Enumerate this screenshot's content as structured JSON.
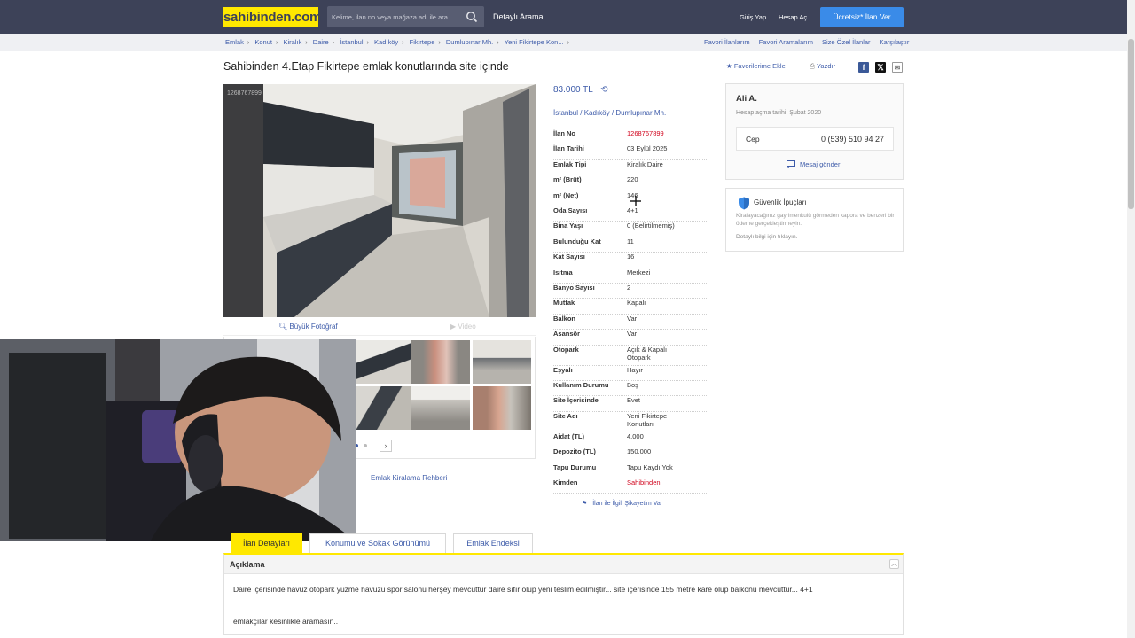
{
  "header": {
    "logo": "sahibinden.com",
    "search_placeholder": "Kelime, ilan no veya mağaza adı ile ara",
    "advanced_search": "Detaylı Arama",
    "login": "Giriş Yap",
    "register": "Hesap Aç",
    "post_ad": "Ücretsiz* İlan Ver"
  },
  "breadcrumb": {
    "items": [
      "Emlak",
      "Konut",
      "Kiralık",
      "Daire",
      "İstanbul",
      "Kadıköy",
      "Fikirtepe",
      "Dumlupınar Mh.",
      "Yeni Fikirtepe Kon..."
    ],
    "right_links": [
      "Favori İlanlarım",
      "Favori Aramalarım",
      "Size Özel İlanlar",
      "Karşılaştır"
    ]
  },
  "listing": {
    "title": "Sahibinden 4.Etap Fikirtepe emlak konutlarında site içinde",
    "add_favorites": "Favorilerime Ekle",
    "print": "Yazdır",
    "photo_id": "1268767899",
    "big_photo": "Büyük Fotoğraf",
    "video": "Video",
    "rental_guide": "Emlak Kiralama Rehberi",
    "price": "83.000 TL",
    "location": [
      "İstanbul",
      "Kadıköy",
      "Dumlupınar Mh."
    ],
    "specs": [
      {
        "label": "İlan No",
        "value": "1268767899"
      },
      {
        "label": "İlan Tarihi",
        "value": "03 Eylül 2025"
      },
      {
        "label": "Emlak Tipi",
        "value": "Kiralık Daire"
      },
      {
        "label": "m² (Brüt)",
        "value": "220"
      },
      {
        "label": "m² (Net)",
        "value": "146"
      },
      {
        "label": "Oda Sayısı",
        "value": "4+1"
      },
      {
        "label": "Bina Yaşı",
        "value": "0 (Belirtilmemiş)"
      },
      {
        "label": "Bulunduğu Kat",
        "value": "11"
      },
      {
        "label": "Kat Sayısı",
        "value": "16"
      },
      {
        "label": "Isıtma",
        "value": "Merkezi"
      },
      {
        "label": "Banyo Sayısı",
        "value": "2"
      },
      {
        "label": "Mutfak",
        "value": "Kapalı"
      },
      {
        "label": "Balkon",
        "value": "Var"
      },
      {
        "label": "Asansör",
        "value": "Var"
      },
      {
        "label": "Otopark",
        "value": "Açık & Kapalı Otopark"
      },
      {
        "label": "Eşyalı",
        "value": "Hayır"
      },
      {
        "label": "Kullanım Durumu",
        "value": "Boş"
      },
      {
        "label": "Site İçerisinde",
        "value": "Evet"
      },
      {
        "label": "Site Adı",
        "value": "Yeni Fikirtepe Konutları"
      },
      {
        "label": "Aidat (TL)",
        "value": "4.000"
      },
      {
        "label": "Depozito (TL)",
        "value": "150.000"
      },
      {
        "label": "Tapu Durumu",
        "value": "Tapu Kaydı Yok"
      },
      {
        "label": "Kimden",
        "value": "Sahibinden"
      }
    ],
    "complaint": "İlan ile İlgili Şikayetim Var"
  },
  "seller": {
    "name": "Ali A.",
    "member_since": "Hesap açma tarihi: Şubat 2020",
    "phone_label": "Cep",
    "phone": "0 (539) 510 94 27",
    "send_message": "Mesaj gönder"
  },
  "safety": {
    "title": "Güvenlik İpuçları",
    "text": "Kiralayacağınız gayrimenkulü görmeden kapora ve benzeri bir ödeme gerçekleştirmeyin.",
    "link": "Detaylı bilgi için tıklayın."
  },
  "tabs": [
    "İlan Detayları",
    "Konumu ve Sokak Görünümü",
    "Emlak Endeksi"
  ],
  "description": {
    "heading": "Açıklama",
    "text1": "Daire içerisinde havuz otopark yüzme havuzu spor salonu herşey mevcuttur daire sıfır olup yeni teslim edilmiştir... site içerisinde 155 metre kare olup balkonu mevcuttur... 4+1",
    "text2": "emlakçılar kesinlikle aramasın.."
  },
  "colors": {
    "header_bg": "#3d4258",
    "logo_yellow": "#ffe800",
    "link_blue": "#3d5ba9",
    "cta_blue": "#3a8be8",
    "red": "#d0021b"
  }
}
